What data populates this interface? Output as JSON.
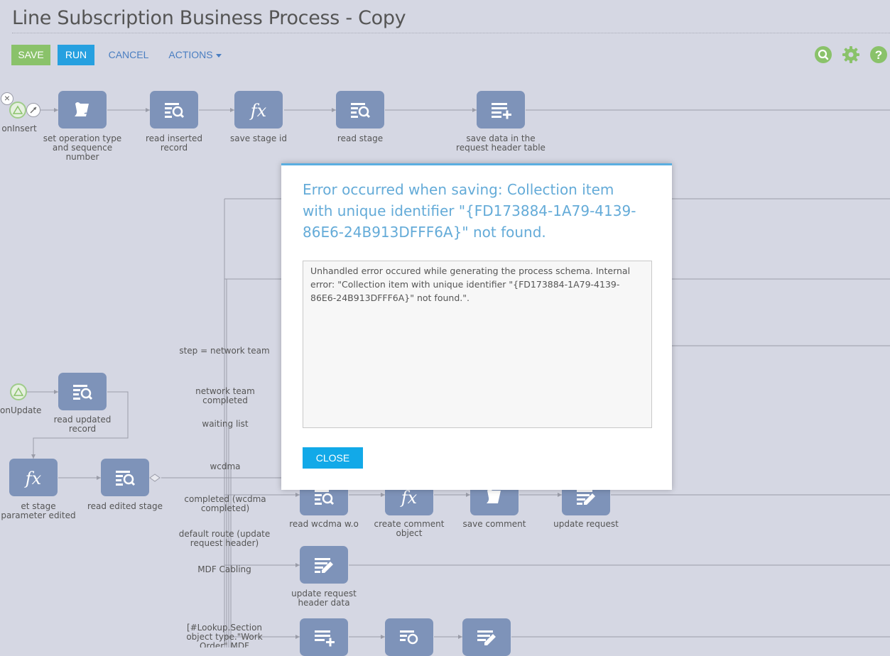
{
  "header": {
    "title": "Line Subscription Business Process - Copy"
  },
  "toolbar": {
    "save_label": "SAVE",
    "run_label": "RUN",
    "cancel_label": "CANCEL",
    "actions_label": "ACTIONS",
    "icons": [
      "search-icon",
      "gear-icon",
      "help-icon"
    ],
    "accent_green": "#8ac26a",
    "accent_blue": "#26a0e0"
  },
  "canvas": {
    "starts": {
      "on_insert": "onInsert",
      "on_update": "onUpdate"
    },
    "nodes": {
      "set_operation": "set operation type and sequence number",
      "read_inserted": "read inserted record",
      "save_stage_id": "save stage id",
      "read_stage": "read stage",
      "save_data_header": "save data in the request header table",
      "read_updated": "read updated record",
      "set_stage_param": "et stage parameter edited",
      "read_edited_stage": "read edited stage",
      "read_wcdma": "read wcdma w.o",
      "create_comment": "create comment object",
      "save_comment": "save comment",
      "update_request": "update request",
      "update_request_header": "update request header data"
    },
    "flows": {
      "step_network": "step = network team",
      "network_completed": "network team completed",
      "waiting_list": "waiting list",
      "wcdma": "wcdma",
      "completed_wcdma": "completed (wcdma completed)",
      "default_route": "default route (update request header)",
      "mdf_cabling": "MDF Cabling",
      "lookup_section": "[#Lookup.Section object type.\"Work Order\".MDF Team#]"
    }
  },
  "modal": {
    "title": "Error occurred when saving: Collection item with unique identifier \"{FD173884-1A79-4139-86E6-24B913DFFF6A}\" not found.",
    "details": "Unhandled error occured while generating the process schema. Internal error: \"Collection item with unique identifier \"{FD173884-1A79-4139-86E6-24B913DFFF6A}\" not found.\".",
    "close_label": "CLOSE"
  }
}
